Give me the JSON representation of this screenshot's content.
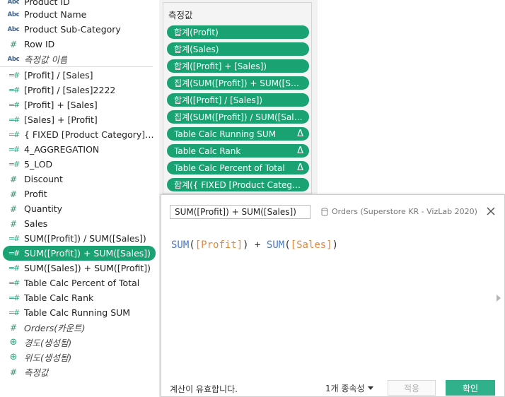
{
  "fields": [
    {
      "icon": "abc",
      "label": "Product ID",
      "italic": false
    },
    {
      "icon": "abc",
      "label": "Product Name",
      "italic": false
    },
    {
      "icon": "abc",
      "label": "Product Sub-Category",
      "italic": false
    },
    {
      "icon": "hash",
      "label": "Row ID",
      "italic": false
    },
    {
      "icon": "abc",
      "label": "측정값 이름",
      "italic": true
    },
    {
      "icon": "calc",
      "label": "[Profit] / [Sales]",
      "italic": false
    },
    {
      "icon": "calc",
      "label": "[Profit] / [Sales]2222",
      "italic": false
    },
    {
      "icon": "calc",
      "label": "[Profit] + [Sales]",
      "italic": false
    },
    {
      "icon": "calc",
      "label": "[Sales] + [Profit]",
      "italic": false
    },
    {
      "icon": "calc",
      "label": "{ FIXED [Product Category] : S...",
      "italic": false
    },
    {
      "icon": "calc",
      "label": "4_AGGREGATION",
      "italic": false
    },
    {
      "icon": "calc",
      "label": "5_LOD",
      "italic": false
    },
    {
      "icon": "hash",
      "label": "Discount",
      "italic": false
    },
    {
      "icon": "hash",
      "label": "Profit",
      "italic": false
    },
    {
      "icon": "hash",
      "label": "Quantity",
      "italic": false
    },
    {
      "icon": "hash",
      "label": "Sales",
      "italic": false
    },
    {
      "icon": "calc",
      "label": "SUM([Profit]) / SUM([Sales])",
      "italic": false
    },
    {
      "icon": "calc",
      "label": "SUM([Profit]) + SUM([Sales])",
      "italic": false,
      "selected": true
    },
    {
      "icon": "calc",
      "label": "SUM([Sales]) + SUM([Profit])",
      "italic": false
    },
    {
      "icon": "calc",
      "label": "Table Calc Percent of Total",
      "italic": false
    },
    {
      "icon": "calc",
      "label": "Table Calc Rank",
      "italic": false
    },
    {
      "icon": "calc",
      "label": "Table Calc Running SUM",
      "italic": false
    },
    {
      "icon": "hash",
      "label": "Orders(카운트)",
      "italic": true
    },
    {
      "icon": "globe",
      "label": "경도(생성됨)",
      "italic": true
    },
    {
      "icon": "globe",
      "label": "위도(생성됨)",
      "italic": true
    },
    {
      "icon": "hash",
      "label": "측정값",
      "italic": true
    }
  ],
  "measures": {
    "title": "측정값",
    "pills": [
      {
        "label": "합계(Profit)",
        "delta": false
      },
      {
        "label": "합계(Sales)",
        "delta": false
      },
      {
        "label": "합계([Profit] + [Sales])",
        "delta": false
      },
      {
        "label": "집계(SUM([Profit]) + SUM([Sales..",
        "delta": false
      },
      {
        "label": "합계([Profit] / [Sales])",
        "delta": false
      },
      {
        "label": "집계(SUM([Profit]) / SUM([Sales]))",
        "delta": false
      },
      {
        "label": "Table Calc Running SUM",
        "delta": true
      },
      {
        "label": "Table Calc Rank",
        "delta": true
      },
      {
        "label": "Table Calc Percent of Total",
        "delta": true
      },
      {
        "label": "합계({ FIXED [Product Category]..",
        "delta": false
      }
    ],
    "delta_symbol": "Δ"
  },
  "editor": {
    "calc_name": "SUM([Profit]) + SUM([Sales])",
    "data_source": "Orders (Superstore KR - VizLab 2020)",
    "formula": {
      "fn1": "SUM",
      "open1": "(",
      "field1": "[Profit]",
      "close1": ")",
      "op": " + ",
      "fn2": "SUM",
      "open2": "(",
      "field2": "[Sales]",
      "close2": ")"
    },
    "status": "계산이 유효합니다.",
    "dependencies": "1개 종속성",
    "apply_label": "적용",
    "ok_label": "확인"
  },
  "colors": {
    "accent": "#1aa273",
    "function": "#4a78c2",
    "field": "#e2873e",
    "ok_button": "#31b08c"
  }
}
